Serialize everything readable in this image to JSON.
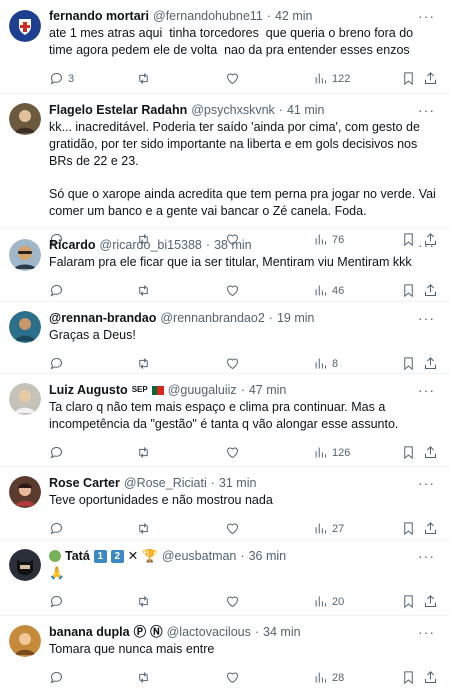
{
  "tweets": [
    {
      "name": "fernando mortari",
      "handle": "@fernandohubne11",
      "time": "42 min",
      "text_paragraphs": [
        "ate 1 mes atras aqui  tinha torcedores  que queria o breno fora do time agora pedem ele de volta  nao da pra entender esses enzos"
      ],
      "replies": "3",
      "retweets": "",
      "likes": "",
      "views": "122",
      "avatar": {
        "bg": "#1e3f8f",
        "icon": "shield-icon"
      }
    },
    {
      "name": "Flagelo Estelar Radahn",
      "handle": "@psychxskvnk",
      "time": "41 min",
      "text_paragraphs": [
        "kk... inacreditável. Poderia ter saído 'ainda por cima', com gesto de gratidão, por ter sido importante na liberta e em gols decisivos nos BRs de 22 e 23.",
        "Só que o xarope ainda acredita que tem perna pra jogar no verde. Vai comer um banco e a gente vai bancar o Zé canela. Foda."
      ],
      "replies": "",
      "retweets": "",
      "likes": "",
      "views": "76",
      "avatar": {
        "bg": "#6b5a3e",
        "icon": "person-icon"
      }
    },
    {
      "name": "Ricardo",
      "handle": "@ricardo_bi15388",
      "time": "38 min",
      "text_paragraphs": [
        "Falaram pra ele ficar que ia ser titular, Mentiram viu Mentiram kkk"
      ],
      "replies": "",
      "retweets": "",
      "likes": "",
      "views": "46",
      "avatar": {
        "bg": "#9fb7c9",
        "icon": "person-icon"
      }
    },
    {
      "name": "@rennan-brandao",
      "handle": "@rennanbrandao2",
      "time": "19 min",
      "text_paragraphs": [
        "Graças a Deus!"
      ],
      "replies": "",
      "retweets": "",
      "likes": "",
      "views": "8",
      "avatar": {
        "bg": "#2c6f8a",
        "icon": "person-icon"
      }
    },
    {
      "name": "Luiz Augusto",
      "handle": "@guugaluiiz",
      "time": "47 min",
      "badge": "SEP",
      "text_paragraphs": [
        "Ta claro q não tem mais espaço e clima pra continuar. Mas a incompetência da \"gestão\" é tanta q vão alongar esse assunto."
      ],
      "replies": "",
      "retweets": "",
      "likes": "",
      "views": "126",
      "avatar": {
        "bg": "#c7c2b8",
        "icon": "person-icon"
      }
    },
    {
      "name": "Rose Carter",
      "handle": "@Rose_Riciati",
      "time": "31 min",
      "text_paragraphs": [
        "Teve oportunidades e não mostrou nada"
      ],
      "replies": "",
      "retweets": "",
      "likes": "",
      "views": "27",
      "avatar": {
        "bg": "#5a3b2e",
        "icon": "person-icon"
      }
    },
    {
      "name": "Tatá",
      "handle": "@eusbatman",
      "time": "36 min",
      "emoji_text": "🙏",
      "text_paragraphs": [],
      "replies": "",
      "retweets": "",
      "likes": "",
      "views": "20",
      "avatar": {
        "bg": "#2a2f3a",
        "icon": "batman-icon"
      }
    },
    {
      "name": "banana dupla",
      "handle": "@lactovacilous",
      "time": "34 min",
      "text_paragraphs": [
        "Tomara que nunca mais entre"
      ],
      "replies": "",
      "retweets": "",
      "likes": "",
      "views": "28",
      "avatar": {
        "bg": "#c58a3a",
        "icon": "person-icon"
      }
    }
  ],
  "badges": {
    "one": "1",
    "two": "2",
    "x": "✕",
    "trophy": "🏆"
  },
  "marks": {
    "p": "Ⓟ",
    "n": "Ⓝ"
  }
}
